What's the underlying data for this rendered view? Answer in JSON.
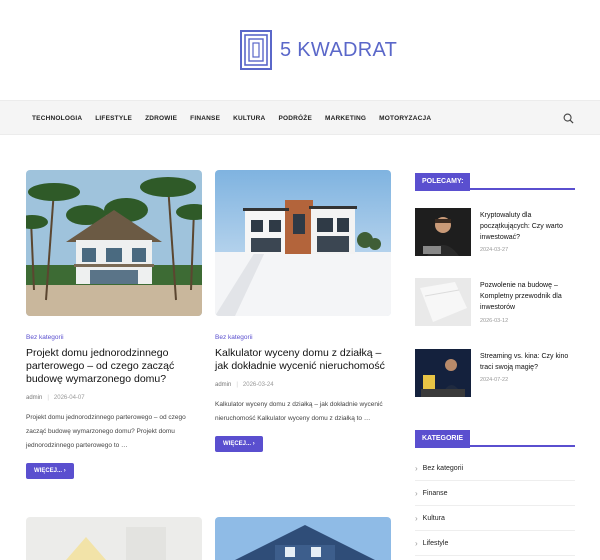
{
  "header": {
    "logo_text": "5 KWADRAT"
  },
  "nav": {
    "items": [
      "TECHNOLOGIA",
      "LIFESTYLE",
      "ZDROWIE",
      "FINANSE",
      "KULTURA",
      "PODRÓŻE",
      "MARKETING",
      "MOTORYZACJA"
    ]
  },
  "posts": [
    {
      "category": "Bez kategorii",
      "title": "Projekt domu jednorodzinnego parterowego – od czego zacząć budowę wymarzonego domu?",
      "author": "admin",
      "date": "2026-04-07",
      "excerpt": "Projekt domu jednorodzinnego parterowego – od czego zacząć budowę wymarzonego domu? Projekt domu jednorodzinnego parterowego to …",
      "more": "WIĘCEJ..."
    },
    {
      "category": "Bez kategorii",
      "title": "Kalkulator wyceny domu z działką – jak dokładnie wycenić nieruchomość",
      "author": "admin",
      "date": "2026-03-24",
      "excerpt": "Kalkulator wyceny domu z działką – jak dokładnie wycenić nieruchomość Kalkulator wyceny domu z działką to …",
      "more": "WIĘCEJ..."
    }
  ],
  "sidebar": {
    "recommended_heading": "POLECAMY:",
    "recommended": [
      {
        "title": "Kryptowaluty dla początkujących: Czy warto inwestować?",
        "date": "2024-03-27"
      },
      {
        "title": "Pozwolenie na budowę – Kompletny przewodnik dla inwestorów",
        "date": "2026-03-12"
      },
      {
        "title": "Streaming vs. kina: Czy kino traci swoją magię?",
        "date": "2024-07-22"
      }
    ],
    "categories_heading": "KATEGORIE",
    "categories": [
      "Bez kategorii",
      "Finanse",
      "Kultura",
      "Lifestyle"
    ]
  },
  "colors": {
    "accent": "#5a4fcf",
    "logo": "#5a67c9"
  }
}
